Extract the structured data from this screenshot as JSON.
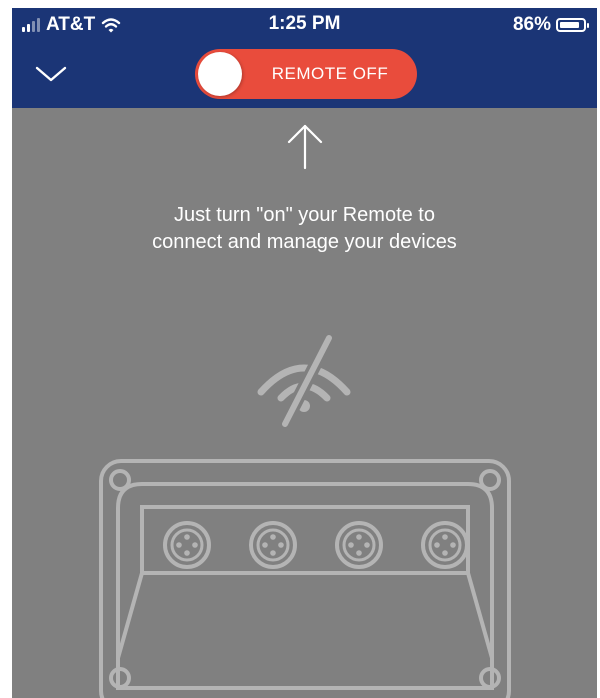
{
  "status_bar": {
    "carrier": "AT&T",
    "time": "1:25 PM",
    "battery_percent": "86%",
    "battery_level": 0.86,
    "signal_bars": 2,
    "signal_bars_total": 4
  },
  "header": {
    "collapse_icon": "chevron-down-icon",
    "remote_toggle": {
      "label": "REMOTE OFF",
      "state": "off"
    }
  },
  "main": {
    "arrow_icon": "arrow-up-icon",
    "instruction_lines": [
      "Just turn \"on\" your Remote to",
      "connect and manage your devices"
    ],
    "status_icon": "no-signal-icon",
    "device_illustration": "remote-hub-illustration",
    "device_ports": 4
  },
  "colors": {
    "header_bg": "#1b3576",
    "screen_bg": "#808080",
    "toggle_bg": "#e94c3c",
    "line_art": "#b4b4b4"
  }
}
